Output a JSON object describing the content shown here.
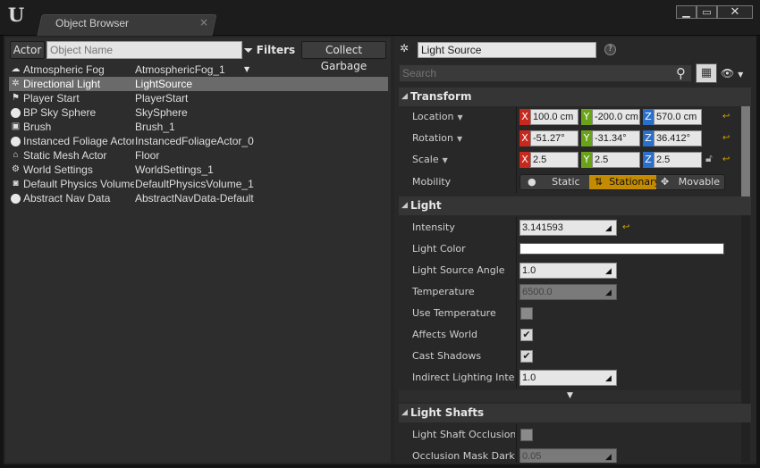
{
  "window": {
    "tab_title": "Object Browser",
    "tab_close": "×",
    "min": "▁",
    "max": "▭",
    "close": "✕"
  },
  "left": {
    "actor_button": "Actor",
    "search_placeholder": "Object Name",
    "filters_label": "Filters",
    "collect_label": "Collect Garbage",
    "rows": [
      {
        "name": "Atmospheric Fog",
        "value": "AtmosphericFog_1",
        "icon": "fog-icon"
      },
      {
        "name": "Directional Light",
        "value": "LightSource",
        "icon": "directional-light-icon",
        "selected": true
      },
      {
        "name": "Player Start",
        "value": "PlayerStart",
        "icon": "player-start-icon"
      },
      {
        "name": "BP Sky Sphere",
        "value": "SkySphere",
        "icon": "sphere-icon"
      },
      {
        "name": "Brush",
        "value": "Brush_1",
        "icon": "brush-icon"
      },
      {
        "name": "Instanced Foliage Actor",
        "value": "InstancedFoliageActor_0",
        "icon": "sphere-icon"
      },
      {
        "name": "Static Mesh Actor",
        "value": "Floor",
        "icon": "static-mesh-icon"
      },
      {
        "name": "World Settings",
        "value": "WorldSettings_1",
        "icon": "world-settings-icon"
      },
      {
        "name": "Default Physics Volume",
        "value": "DefaultPhysicsVolume_1",
        "icon": "physics-volume-icon"
      },
      {
        "name": "Abstract Nav Data",
        "value": "AbstractNavData-Default",
        "icon": "sphere-icon"
      }
    ]
  },
  "details": {
    "actor_name": "Light Source",
    "help": "?",
    "search_placeholder": "Search",
    "categories": {
      "transform": "Transform",
      "light": "Light",
      "light_shafts": "Light Shafts"
    },
    "transform": {
      "location_label": "Location",
      "location": {
        "x": "100.0 cm",
        "y": "-200.0 cm",
        "z": "570.0 cm"
      },
      "rotation_label": "Rotation",
      "rotation": {
        "x": "-51.27°",
        "y": "-31.34°",
        "z": "36.412°"
      },
      "scale_label": "Scale",
      "scale": {
        "x": "2.5",
        "y": "2.5",
        "z": "2.5"
      },
      "mobility_label": "Mobility",
      "mobility_options": [
        "Static",
        "Stationary",
        "Movable"
      ],
      "mobility_selected": "Stationary"
    },
    "light": {
      "intensity_label": "Intensity",
      "intensity": "3.141593",
      "light_color_label": "Light Color",
      "light_color": "#ffffff",
      "source_angle_label": "Light Source Angle",
      "source_angle": "1.0",
      "temperature_label": "Temperature",
      "temperature": "6500.0",
      "use_temperature_label": "Use Temperature",
      "use_temperature": false,
      "affects_world_label": "Affects World",
      "affects_world": true,
      "cast_shadows_label": "Cast Shadows",
      "cast_shadows": true,
      "indirect_label": "Indirect Lighting Intensity",
      "indirect": "1.0"
    },
    "light_shafts": {
      "occlusion_label": "Light Shaft Occlusion",
      "occlusion": false,
      "mask_label": "Occlusion Mask Darkness",
      "mask": "0.05"
    }
  },
  "colors": {
    "x_axis": "#c9281c",
    "y_axis": "#6aa317",
    "z_axis": "#2a6fc9",
    "selected": "#c48a00"
  }
}
